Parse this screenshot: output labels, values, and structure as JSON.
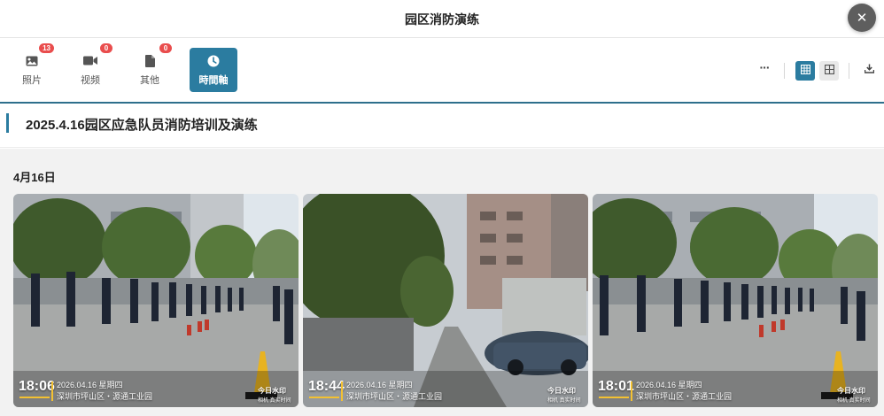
{
  "window": {
    "title": "园区消防演练"
  },
  "tabs": [
    {
      "label": "照片",
      "count": "13",
      "icon": "image-icon"
    },
    {
      "label": "视频",
      "count": "0",
      "icon": "video-camera-icon"
    },
    {
      "label": "其他",
      "count": "0",
      "icon": "document-icon"
    },
    {
      "label": "時間軸",
      "icon": "clock-icon",
      "active": true
    }
  ],
  "toolbar": {
    "more_label": "···"
  },
  "album": {
    "title": "2025.4.16园区应急队员消防培训及演练"
  },
  "group": {
    "date_label": "4月16日"
  },
  "photos": [
    {
      "time": "18:06",
      "date": "2026.04.16 星期四",
      "location": "深圳市坪山区・源通工业园",
      "logo": "今日水印",
      "logo_sub": "相机 真实时间"
    },
    {
      "time": "18:44",
      "date": "2026.04.16 星期四",
      "location": "深圳市坪山区・源通工业园",
      "logo": "今日水印",
      "logo_sub": "相机 真实时间"
    },
    {
      "time": "18:01",
      "date": "2026.04.16 星期四",
      "location": "深圳市坪山区・源通工业园",
      "logo": "今日水印",
      "logo_sub": "相机 真实时间"
    }
  ],
  "colors": {
    "accent": "#2b7ca0",
    "badge": "#e94d4d",
    "watermark": "#f3c132"
  }
}
